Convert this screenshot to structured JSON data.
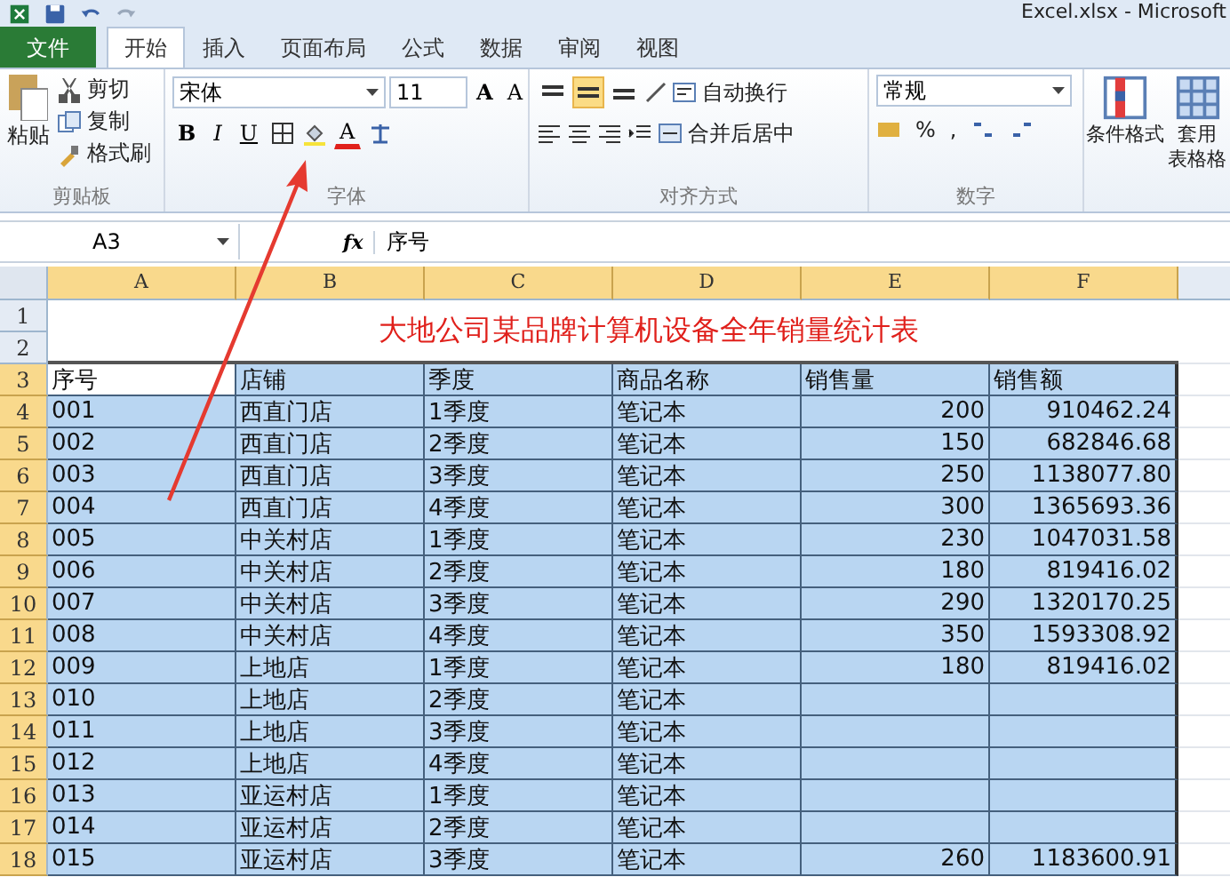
{
  "window": {
    "title": "Excel.xlsx - Microsoft"
  },
  "tabs": [
    {
      "label": "文件",
      "kind": "file",
      "selected": false
    },
    {
      "label": "开始",
      "kind": "tab",
      "selected": true
    },
    {
      "label": "插入",
      "kind": "tab",
      "selected": false
    },
    {
      "label": "页面布局",
      "kind": "tab",
      "selected": false
    },
    {
      "label": "公式",
      "kind": "tab",
      "selected": false
    },
    {
      "label": "数据",
      "kind": "tab",
      "selected": false
    },
    {
      "label": "审阅",
      "kind": "tab",
      "selected": false
    },
    {
      "label": "视图",
      "kind": "tab",
      "selected": false
    }
  ],
  "clipboard": {
    "paste": "粘贴",
    "cut": "剪切",
    "copy": "复制",
    "format_painter": "格式刷",
    "label": "剪贴板"
  },
  "font": {
    "name": "宋体",
    "size": "11",
    "grow": "A",
    "shrink": "A",
    "bold": "B",
    "italic": "I",
    "underline": "U",
    "color_letter": "A",
    "label": "字体"
  },
  "alignment": {
    "vertical": [
      {
        "selected": false
      },
      {
        "selected": true
      },
      {
        "selected": false
      }
    ],
    "wrap": "自动换行",
    "merge": "合并后居中",
    "label": "对齐方式"
  },
  "number": {
    "format": "常规",
    "percent": "%",
    "comma": ",",
    "label": "数字"
  },
  "styles": {
    "conditional": "条件格式",
    "table_line1": "套用",
    "table_line2": "表格格"
  },
  "formula_bar": {
    "name_box": "A3",
    "fx": "fx",
    "value": "序号"
  },
  "sheet": {
    "columns": [
      {
        "label": "A",
        "selected": true
      },
      {
        "label": "B",
        "selected": true
      },
      {
        "label": "C",
        "selected": true
      },
      {
        "label": "D",
        "selected": true
      },
      {
        "label": "E",
        "selected": true
      },
      {
        "label": "F",
        "selected": true
      }
    ],
    "title_rows": [
      "1",
      "2"
    ],
    "title": "大地公司某品牌计算机设备全年销量统计表",
    "rows": [
      {
        "header": "3",
        "selected": true,
        "active": true,
        "cells": [
          "序号",
          "店铺",
          "季度",
          "商品名称",
          "销售量",
          "销售额"
        ]
      },
      {
        "header": "4",
        "selected": true,
        "active": false,
        "cells": [
          "001",
          "西直门店",
          "1季度",
          "笔记本",
          "200",
          "910462.24"
        ]
      },
      {
        "header": "5",
        "selected": true,
        "active": false,
        "cells": [
          "002",
          "西直门店",
          "2季度",
          "笔记本",
          "150",
          "682846.68"
        ]
      },
      {
        "header": "6",
        "selected": true,
        "active": false,
        "cells": [
          "003",
          "西直门店",
          "3季度",
          "笔记本",
          "250",
          "1138077.80"
        ]
      },
      {
        "header": "7",
        "selected": true,
        "active": false,
        "cells": [
          "004",
          "西直门店",
          "4季度",
          "笔记本",
          "300",
          "1365693.36"
        ]
      },
      {
        "header": "8",
        "selected": true,
        "active": false,
        "cells": [
          "005",
          "中关村店",
          "1季度",
          "笔记本",
          "230",
          "1047031.58"
        ]
      },
      {
        "header": "9",
        "selected": true,
        "active": false,
        "cells": [
          "006",
          "中关村店",
          "2季度",
          "笔记本",
          "180",
          "819416.02"
        ]
      },
      {
        "header": "10",
        "selected": true,
        "active": false,
        "cells": [
          "007",
          "中关村店",
          "3季度",
          "笔记本",
          "290",
          "1320170.25"
        ]
      },
      {
        "header": "11",
        "selected": true,
        "active": false,
        "cells": [
          "008",
          "中关村店",
          "4季度",
          "笔记本",
          "350",
          "1593308.92"
        ]
      },
      {
        "header": "12",
        "selected": true,
        "active": false,
        "cells": [
          "009",
          "上地店",
          "1季度",
          "笔记本",
          "180",
          "819416.02"
        ]
      },
      {
        "header": "13",
        "selected": true,
        "active": false,
        "cells": [
          "010",
          "上地店",
          "2季度",
          "笔记本"
        ]
      },
      {
        "header": "14",
        "selected": true,
        "active": false,
        "cells": [
          "011",
          "上地店",
          "3季度",
          "笔记本"
        ]
      },
      {
        "header": "15",
        "selected": true,
        "active": false,
        "cells": [
          "012",
          "上地店",
          "4季度",
          "笔记本"
        ]
      },
      {
        "header": "16",
        "selected": true,
        "active": false,
        "cells": [
          "013",
          "亚运村店",
          "1季度",
          "笔记本"
        ]
      },
      {
        "header": "17",
        "selected": true,
        "active": false,
        "cells": [
          "014",
          "亚运村店",
          "2季度",
          "笔记本"
        ]
      },
      {
        "header": "18",
        "selected": true,
        "active": false,
        "cells": [
          "015",
          "亚运村店",
          "3季度",
          "笔记本",
          "260",
          "1183600.91"
        ]
      }
    ]
  }
}
